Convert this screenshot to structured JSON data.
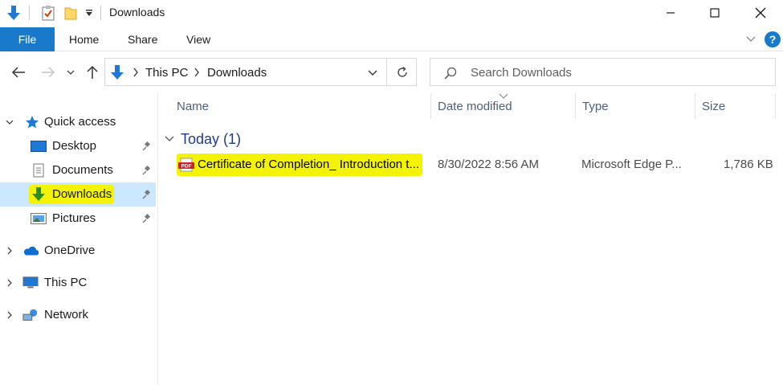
{
  "window": {
    "title": "Downloads",
    "controls": {
      "minimize": "—",
      "maximize": "☐",
      "close": "✕"
    }
  },
  "ribbon": {
    "tabs": [
      {
        "label": "File",
        "active": true
      },
      {
        "label": "Home"
      },
      {
        "label": "Share"
      },
      {
        "label": "View"
      }
    ],
    "help": "?"
  },
  "address": {
    "path": [
      "This PC",
      "Downloads"
    ]
  },
  "search": {
    "placeholder": "Search Downloads"
  },
  "nav": {
    "quick_access": "Quick access",
    "pinned": [
      {
        "label": "Desktop",
        "icon": "desktop-icon"
      },
      {
        "label": "Documents",
        "icon": "documents-icon"
      },
      {
        "label": "Downloads",
        "icon": "download-arrow-icon",
        "selected": true,
        "highlighted": true
      },
      {
        "label": "Pictures",
        "icon": "pictures-icon"
      }
    ],
    "roots": [
      {
        "label": "OneDrive",
        "icon": "onedrive-icon"
      },
      {
        "label": "This PC",
        "icon": "this-pc-icon"
      },
      {
        "label": "Network",
        "icon": "network-icon"
      }
    ]
  },
  "columns": [
    "Name",
    "Date modified",
    "Type",
    "Size"
  ],
  "groups": [
    {
      "label": "Today (1)",
      "files": [
        {
          "name": "Certificate of Completion_ Introduction t...",
          "date": "8/30/2022 8:56 AM",
          "type": "Microsoft Edge P...",
          "size": "1,786 KB",
          "icon": "pdf-icon",
          "highlighted": true
        }
      ]
    }
  ],
  "colors": {
    "accent": "#1979ca",
    "selection": "#cce8ff",
    "highlight": "#f4f400",
    "group_text": "#1e3a8a",
    "column_header_text": "#4c607a"
  }
}
